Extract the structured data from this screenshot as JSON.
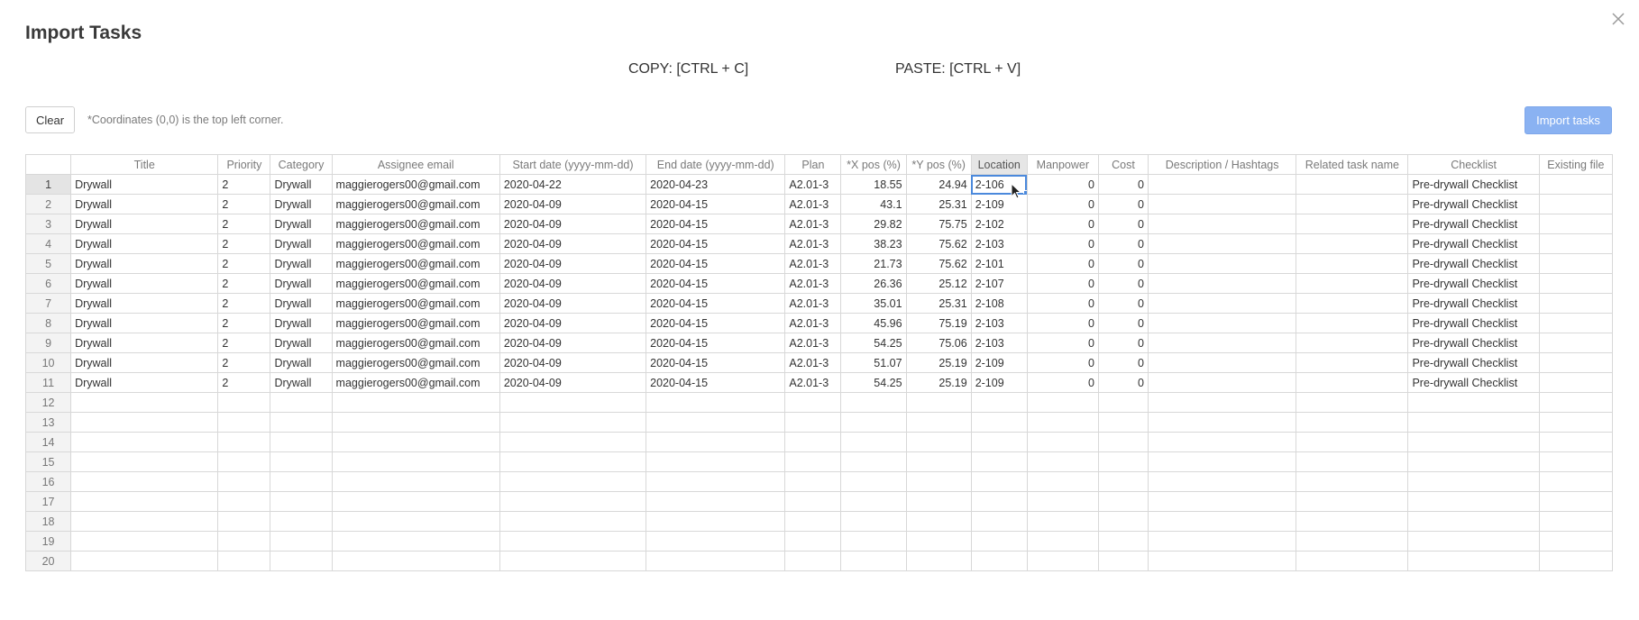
{
  "modal": {
    "title": "Import Tasks",
    "close_icon": "close-icon"
  },
  "shortcuts": {
    "copy": "COPY: [CTRL + C]",
    "paste": "PASTE: [CTRL + V]"
  },
  "toolbar": {
    "clear_label": "Clear",
    "coordinates_note": "*Coordinates (0,0) is the top left corner.",
    "import_label": "Import tasks"
  },
  "colors": {
    "import_button": "#8ab2f2",
    "selection": "#4b89dc"
  },
  "grid": {
    "columns": [
      "Title",
      "Priority",
      "Category",
      "Assignee email",
      "Start date (yyyy-mm-dd)",
      "End date (yyyy-mm-dd)",
      "Plan",
      "*X pos (%)",
      "*Y pos (%)",
      "Location",
      "Manpower",
      "Cost",
      "Description / Hashtags",
      "Related task name",
      "Checklist",
      "Existing file"
    ],
    "active_column": "Location",
    "selected_cell": {
      "row": 1,
      "column": "Location"
    },
    "total_rows": 20,
    "rows": [
      [
        "Drywall",
        "2",
        "Drywall",
        "maggierogers00@gmail.com",
        "2020-04-22",
        "2020-04-23",
        "A2.01-3",
        "18.55",
        "24.94",
        "2-106",
        "0",
        "0",
        "",
        "",
        "Pre-drywall Checklist",
        ""
      ],
      [
        "Drywall",
        "2",
        "Drywall",
        "maggierogers00@gmail.com",
        "2020-04-09",
        "2020-04-15",
        "A2.01-3",
        "43.1",
        "25.31",
        "2-109",
        "0",
        "0",
        "",
        "",
        "Pre-drywall Checklist",
        ""
      ],
      [
        "Drywall",
        "2",
        "Drywall",
        "maggierogers00@gmail.com",
        "2020-04-09",
        "2020-04-15",
        "A2.01-3",
        "29.82",
        "75.75",
        "2-102",
        "0",
        "0",
        "",
        "",
        "Pre-drywall Checklist",
        ""
      ],
      [
        "Drywall",
        "2",
        "Drywall",
        "maggierogers00@gmail.com",
        "2020-04-09",
        "2020-04-15",
        "A2.01-3",
        "38.23",
        "75.62",
        "2-103",
        "0",
        "0",
        "",
        "",
        "Pre-drywall Checklist",
        ""
      ],
      [
        "Drywall",
        "2",
        "Drywall",
        "maggierogers00@gmail.com",
        "2020-04-09",
        "2020-04-15",
        "A2.01-3",
        "21.73",
        "75.62",
        "2-101",
        "0",
        "0",
        "",
        "",
        "Pre-drywall Checklist",
        ""
      ],
      [
        "Drywall",
        "2",
        "Drywall",
        "maggierogers00@gmail.com",
        "2020-04-09",
        "2020-04-15",
        "A2.01-3",
        "26.36",
        "25.12",
        "2-107",
        "0",
        "0",
        "",
        "",
        "Pre-drywall Checklist",
        ""
      ],
      [
        "Drywall",
        "2",
        "Drywall",
        "maggierogers00@gmail.com",
        "2020-04-09",
        "2020-04-15",
        "A2.01-3",
        "35.01",
        "25.31",
        "2-108",
        "0",
        "0",
        "",
        "",
        "Pre-drywall Checklist",
        ""
      ],
      [
        "Drywall",
        "2",
        "Drywall",
        "maggierogers00@gmail.com",
        "2020-04-09",
        "2020-04-15",
        "A2.01-3",
        "45.96",
        "75.19",
        "2-103",
        "0",
        "0",
        "",
        "",
        "Pre-drywall Checklist",
        ""
      ],
      [
        "Drywall",
        "2",
        "Drywall",
        "maggierogers00@gmail.com",
        "2020-04-09",
        "2020-04-15",
        "A2.01-3",
        "54.25",
        "75.06",
        "2-103",
        "0",
        "0",
        "",
        "",
        "Pre-drywall Checklist",
        ""
      ],
      [
        "Drywall",
        "2",
        "Drywall",
        "maggierogers00@gmail.com",
        "2020-04-09",
        "2020-04-15",
        "A2.01-3",
        "51.07",
        "25.19",
        "2-109",
        "0",
        "0",
        "",
        "",
        "Pre-drywall Checklist",
        ""
      ],
      [
        "Drywall",
        "2",
        "Drywall",
        "maggierogers00@gmail.com",
        "2020-04-09",
        "2020-04-15",
        "A2.01-3",
        "54.25",
        "25.19",
        "2-109",
        "0",
        "0",
        "",
        "",
        "Pre-drywall Checklist",
        ""
      ]
    ]
  }
}
